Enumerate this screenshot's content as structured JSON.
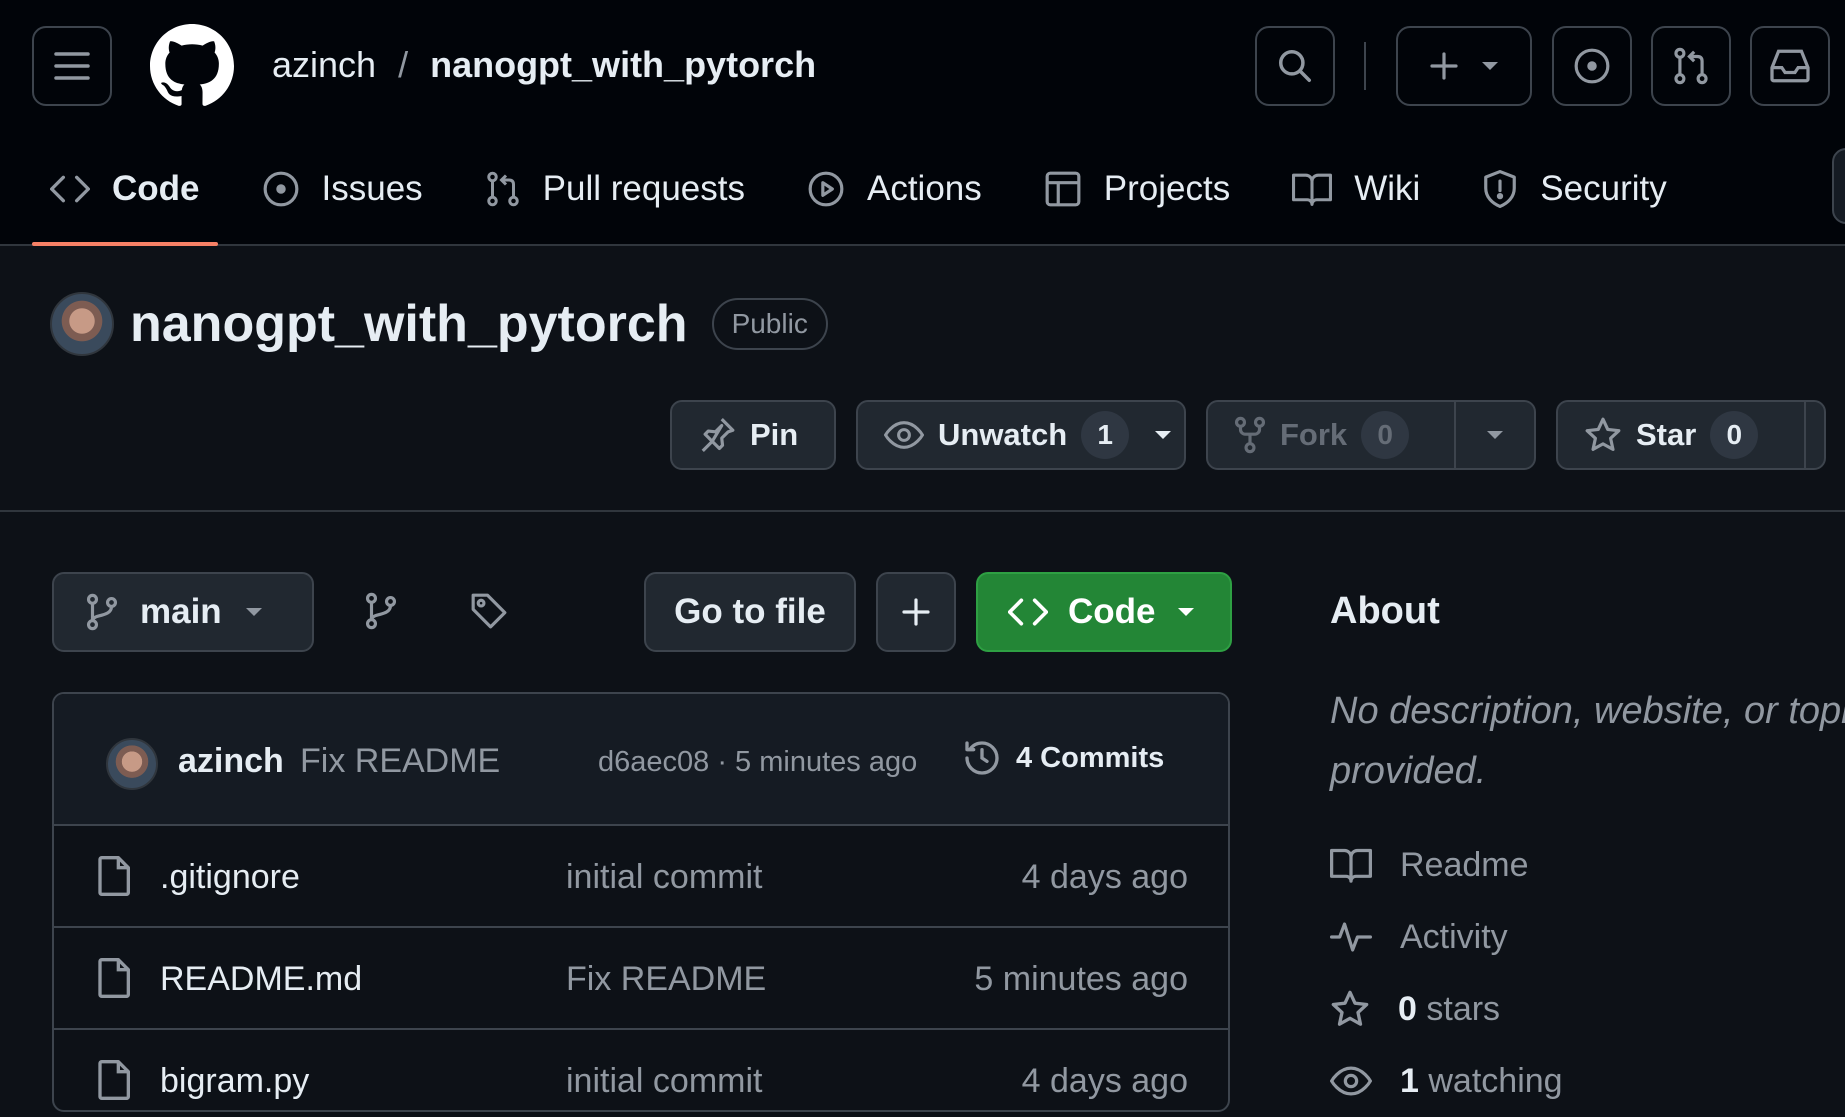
{
  "header": {
    "owner": "azinch",
    "separator": "/",
    "repo": "nanogpt_with_pytorch"
  },
  "tabs": [
    {
      "label": "Code",
      "icon": "code-icon"
    },
    {
      "label": "Issues",
      "icon": "issue-icon"
    },
    {
      "label": "Pull requests",
      "icon": "pull-request-icon"
    },
    {
      "label": "Actions",
      "icon": "play-icon"
    },
    {
      "label": "Projects",
      "icon": "table-icon"
    },
    {
      "label": "Wiki",
      "icon": "book-icon"
    },
    {
      "label": "Security",
      "icon": "shield-icon"
    }
  ],
  "repo": {
    "title": "nanogpt_with_pytorch",
    "visibility": "Public",
    "pin_label": "Pin",
    "unwatch_label": "Unwatch",
    "watch_count": "1",
    "fork_label": "Fork",
    "fork_count": "0",
    "star_label": "Star",
    "star_count": "0"
  },
  "toolbar": {
    "branch": "main",
    "goto_file": "Go to file",
    "code_label": "Code"
  },
  "latest_commit": {
    "author": "azinch",
    "message": "Fix README",
    "meta": "d6aec08 · 5 minutes ago",
    "commits": "4 Commits"
  },
  "files": [
    {
      "name": ".gitignore",
      "message": "initial commit",
      "date": "4 days ago"
    },
    {
      "name": "README.md",
      "message": "Fix README",
      "date": "5 minutes ago"
    },
    {
      "name": "bigram.py",
      "message": "initial commit",
      "date": "4 days ago"
    }
  ],
  "about": {
    "title": "About",
    "description_line1": "No description, website, or topics",
    "description_line2": "provided.",
    "readme": "Readme",
    "activity": "Activity",
    "stars_count": "0",
    "stars_label": "stars",
    "watching_count": "1",
    "watching_label": "watching"
  },
  "colors": {
    "accent": "#f78166",
    "primary_button": "#238636",
    "background": "#0d1117"
  }
}
